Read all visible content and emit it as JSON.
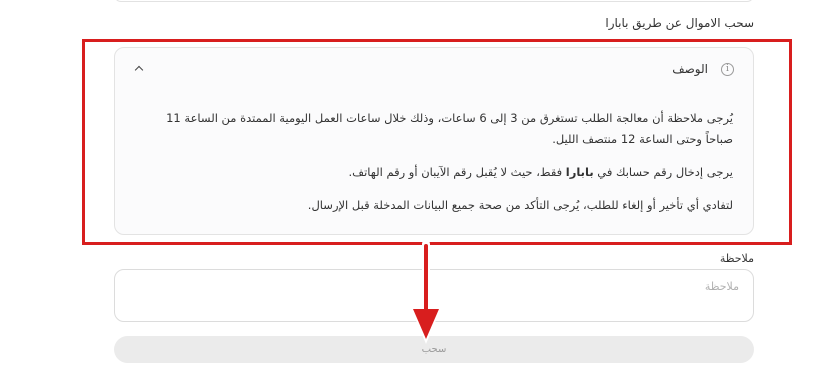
{
  "page": {
    "section_title": "سحب الاموال عن طريق بابارا"
  },
  "description": {
    "title": "الوصف",
    "info_icon": "info-icon",
    "toggle_icon": "chevron-up-icon",
    "paragraph1": "يُرجى ملاحظة أن معالجة الطلب تستغرق من 3 إلى 6 ساعات، وذلك خلال ساعات العمل اليومية الممتدة من الساعة 11 صباحاً وحتى الساعة 12 منتصف الليل.",
    "paragraph2_before": "يرجى إدخال رقم حسابك في ",
    "paragraph2_bold": "بابارا",
    "paragraph2_after": " فقط، حيث لا يُقبل رقم الآيبان أو رقم الهاتف.",
    "paragraph3": "لتفادي أي تأخير أو إلغاء للطلب، يُرجى التأكد من صحة جميع البيانات المدخلة قبل الإرسال."
  },
  "note": {
    "label": "ملاحظة",
    "placeholder": "ملاحظة",
    "value": ""
  },
  "submit": {
    "label": "سحب"
  },
  "annotation": {
    "highlight_color": "#d81e1e",
    "arrow_color": "#d81e1e"
  }
}
